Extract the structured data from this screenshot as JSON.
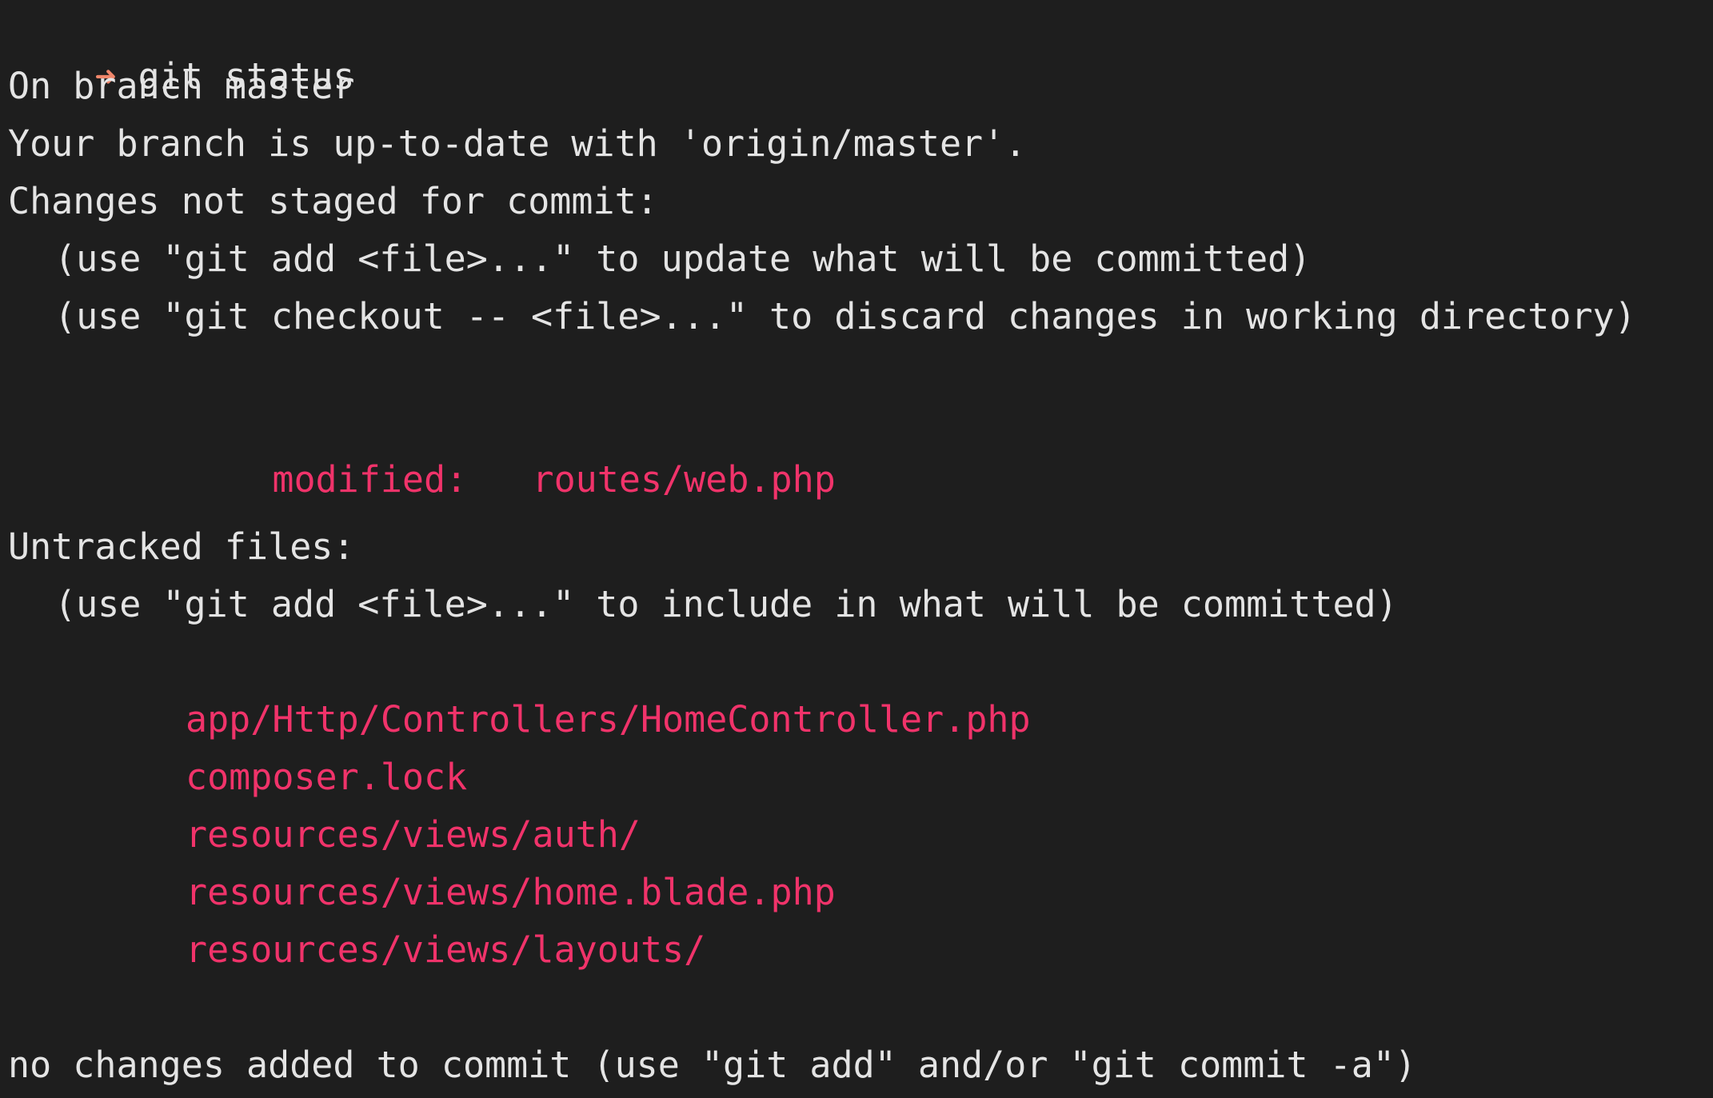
{
  "colors": {
    "background": "#1e1e1e",
    "text": "#e4e4e4",
    "path": "#f0336a",
    "prompt_arrow": "#f0866a"
  },
  "prompt": {
    "icon": "arrow-right-icon",
    "glyph": "➜",
    "command": "git status"
  },
  "status": {
    "branch": "On branch master",
    "up_to_date": "Your branch is up-to-date with 'origin/master'."
  },
  "unstaged": {
    "header": "Changes not staged for commit:",
    "hints": [
      "(use \"git add <file>...\" to update what will be committed)",
      "(use \"git checkout -- <file>...\" to discard changes in working directory)"
    ],
    "files": [
      {
        "state": "modified:",
        "path": "routes/web.php"
      }
    ]
  },
  "untracked": {
    "header": "Untracked files:",
    "hint": "(use \"git add <file>...\" to include in what will be committed)",
    "files": [
      "app/Http/Controllers/HomeController.php",
      "composer.lock",
      "resources/views/auth/",
      "resources/views/home.blade.php",
      "resources/views/layouts/"
    ]
  },
  "footer": "no changes added to commit (use \"git add\" and/or \"git commit -a\")"
}
